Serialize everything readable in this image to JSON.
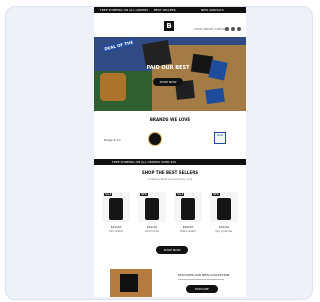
{
  "topbar": {
    "items": [
      "FREE SHIPPING ON ALL ORDERS",
      "BEST SELLERS",
      "NEW ARRIVALS"
    ]
  },
  "logo": {
    "text": "B"
  },
  "nav": {
    "links": "SHOP   ABOUT   CONTACT"
  },
  "hero": {
    "badge": "DEAL OF THE",
    "headline": "PAID OUR BEST",
    "cta": "SHOP NOW"
  },
  "brands": {
    "title": "BRANDS WE LOVE",
    "items": [
      "Ridge & Co",
      "Seal",
      "Vault"
    ]
  },
  "announcement": {
    "text": "FREE SHIPPING ON ALL ORDERS OVER $50"
  },
  "products_section": {
    "title": "SHOP THE BEST SELLERS",
    "subtitle": "Curated wallets and everyday carry",
    "items": [
      {
        "tag": "SALE",
        "price": "$49.00",
        "name": "Slim wallet"
      },
      {
        "tag": "NEW",
        "price": "$59.00",
        "name": "Card holder"
      },
      {
        "tag": "SALE",
        "price": "$69.00",
        "name": "Bifold wallet"
      },
      {
        "tag": "NEW",
        "price": "$39.00",
        "name": "Key organizer"
      }
    ],
    "button": "SHOP NOW"
  },
  "bottom": {
    "title": "DISCOVER OUR NEW COLLECTION",
    "cta": "EXPLORE"
  }
}
